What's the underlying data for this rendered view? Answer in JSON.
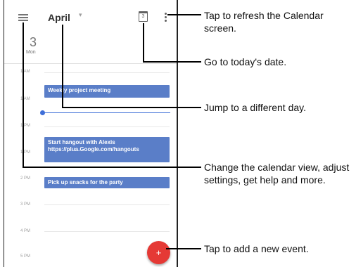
{
  "app": {
    "month": "April",
    "day_number": "3",
    "day_name": "Mon",
    "today_icon_text": "3"
  },
  "hours": [
    "1 AM",
    "1 AM",
    "1 PM",
    "1 PM",
    "2 PM",
    "3 PM",
    "4 PM",
    "5 PM"
  ],
  "events": [
    {
      "title": "Weekly project meeting"
    },
    {
      "title": "Start hangout with Alexis",
      "subtitle": "https://plua.Google.com/hangouts"
    },
    {
      "title": "Pick up snacks for the party"
    }
  ],
  "fab": {
    "label": "+"
  },
  "callouts": {
    "refresh": "Tap to refresh the Calendar screen.",
    "today": "Go to today's date.",
    "jump": "Jump to a different day.",
    "view": "Change the calendar view, adjust settings, get help and more.",
    "add": "Tap to add a new event."
  },
  "colors": {
    "event_blue": "#5a7ec8",
    "fab_red": "#e53935",
    "now_line": "#3f6fd8"
  }
}
